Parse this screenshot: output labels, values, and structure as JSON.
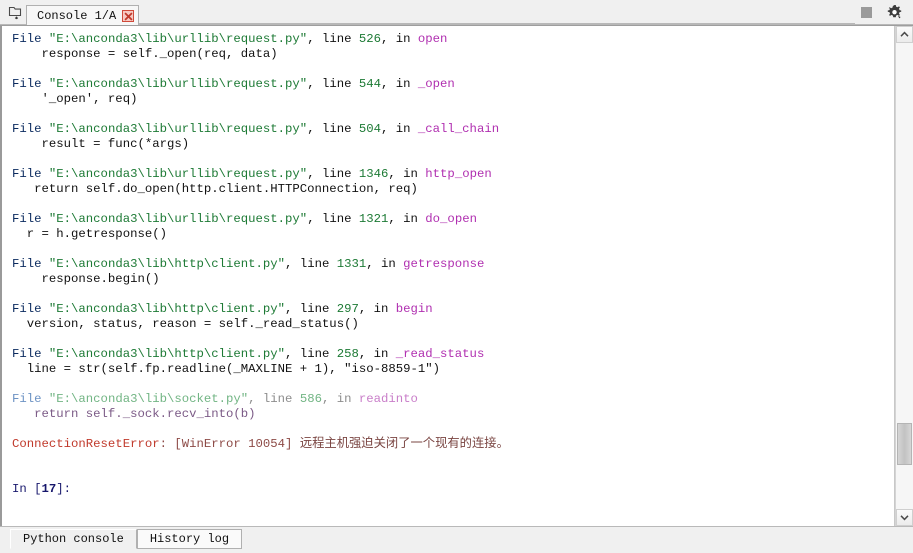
{
  "window": {
    "title": "Console 1/A"
  },
  "toolbar": {
    "browse_icon": "browse-tabs-icon",
    "stop_button_label": "",
    "options_icon": "gear-icon",
    "stop_icon": "stop-square-icon"
  },
  "tab": {
    "label": "Console 1/A",
    "close_label": "x"
  },
  "console": {
    "lines": [
      {
        "type": "frame",
        "file_kw": "File ",
        "path": "\"E:\\anconda3\\lib\\urllib\\request.py\"",
        "comma": ", ",
        "line_kw": "line ",
        "line_no": "526",
        "in_kw": ", in ",
        "func": "open",
        "code": "    response = self._open(req, data)"
      },
      {
        "type": "frame",
        "file_kw": "File ",
        "path": "\"E:\\anconda3\\lib\\urllib\\request.py\"",
        "comma": ", ",
        "line_kw": "line ",
        "line_no": "544",
        "in_kw": ", in ",
        "func": "_open",
        "code": "    '_open', req)"
      },
      {
        "type": "frame",
        "file_kw": "File ",
        "path": "\"E:\\anconda3\\lib\\urllib\\request.py\"",
        "comma": ", ",
        "line_kw": "line ",
        "line_no": "504",
        "in_kw": ", in ",
        "func": "_call_chain",
        "code": "    result = func(*args)"
      },
      {
        "type": "frame",
        "file_kw": "File ",
        "path": "\"E:\\anconda3\\lib\\urllib\\request.py\"",
        "comma": ", ",
        "line_kw": "line ",
        "line_no": "1346",
        "in_kw": ", in ",
        "func": "http_open",
        "code": "   return self.do_open(http.client.HTTPConnection, req)"
      },
      {
        "type": "frame",
        "file_kw": "File ",
        "path": "\"E:\\anconda3\\lib\\urllib\\request.py\"",
        "comma": ", ",
        "line_kw": "line ",
        "line_no": "1321",
        "in_kw": ", in ",
        "func": "do_open",
        "code": "  r = h.getresponse()"
      },
      {
        "type": "frame",
        "file_kw": "File ",
        "path": "\"E:\\anconda3\\lib\\http\\client.py\"",
        "comma": ", ",
        "line_kw": "line ",
        "line_no": "1331",
        "in_kw": ", in ",
        "func": "getresponse",
        "code": "    response.begin()"
      },
      {
        "type": "frame",
        "file_kw": "File ",
        "path": "\"E:\\anconda3\\lib\\http\\client.py\"",
        "comma": ", ",
        "line_kw": "line ",
        "line_no": "297",
        "in_kw": ", in ",
        "func": "begin",
        "code": "  version, status, reason = self._read_status()"
      },
      {
        "type": "frame",
        "file_kw": "File ",
        "path": "\"E:\\anconda3\\lib\\http\\client.py\"",
        "comma": ", ",
        "line_kw": "line ",
        "line_no": "258",
        "in_kw": ", in ",
        "func": "_read_status",
        "code": "  line = str(self.fp.readline(_MAXLINE + 1), \"iso-8859-1\")"
      },
      {
        "type": "frame-faded",
        "file_kw": "File ",
        "path": "\"E:\\anconda3\\lib\\socket.py\"",
        "comma": ", ",
        "line_kw": "line ",
        "line_no": "586",
        "in_kw": ", in ",
        "func": "readinto",
        "code": "   return self._sock.recv_into(b)"
      }
    ],
    "error": {
      "name": "ConnectionResetError",
      "rest": ": [WinError 10054] ",
      "message": "远程主机强迫关闭了一个现有的连接。"
    },
    "prompt": {
      "in_kw": "In [",
      "number": "17",
      "suffix": "]:"
    }
  },
  "scrollbar": {
    "up_arrow": "chevron-up-icon",
    "down_arrow": "chevron-down-icon"
  },
  "bottom_tabs": [
    {
      "label": "Python console",
      "active": true
    },
    {
      "label": "History log",
      "active": false
    }
  ],
  "colors": {
    "file_keyword": "#0a2a5e",
    "path_string": "#1d7a35",
    "function_name": "#b02fb0",
    "error_name": "#c0392b",
    "prompt": "#16166b",
    "background": "#ffffff",
    "chrome": "#f0f0f0"
  }
}
